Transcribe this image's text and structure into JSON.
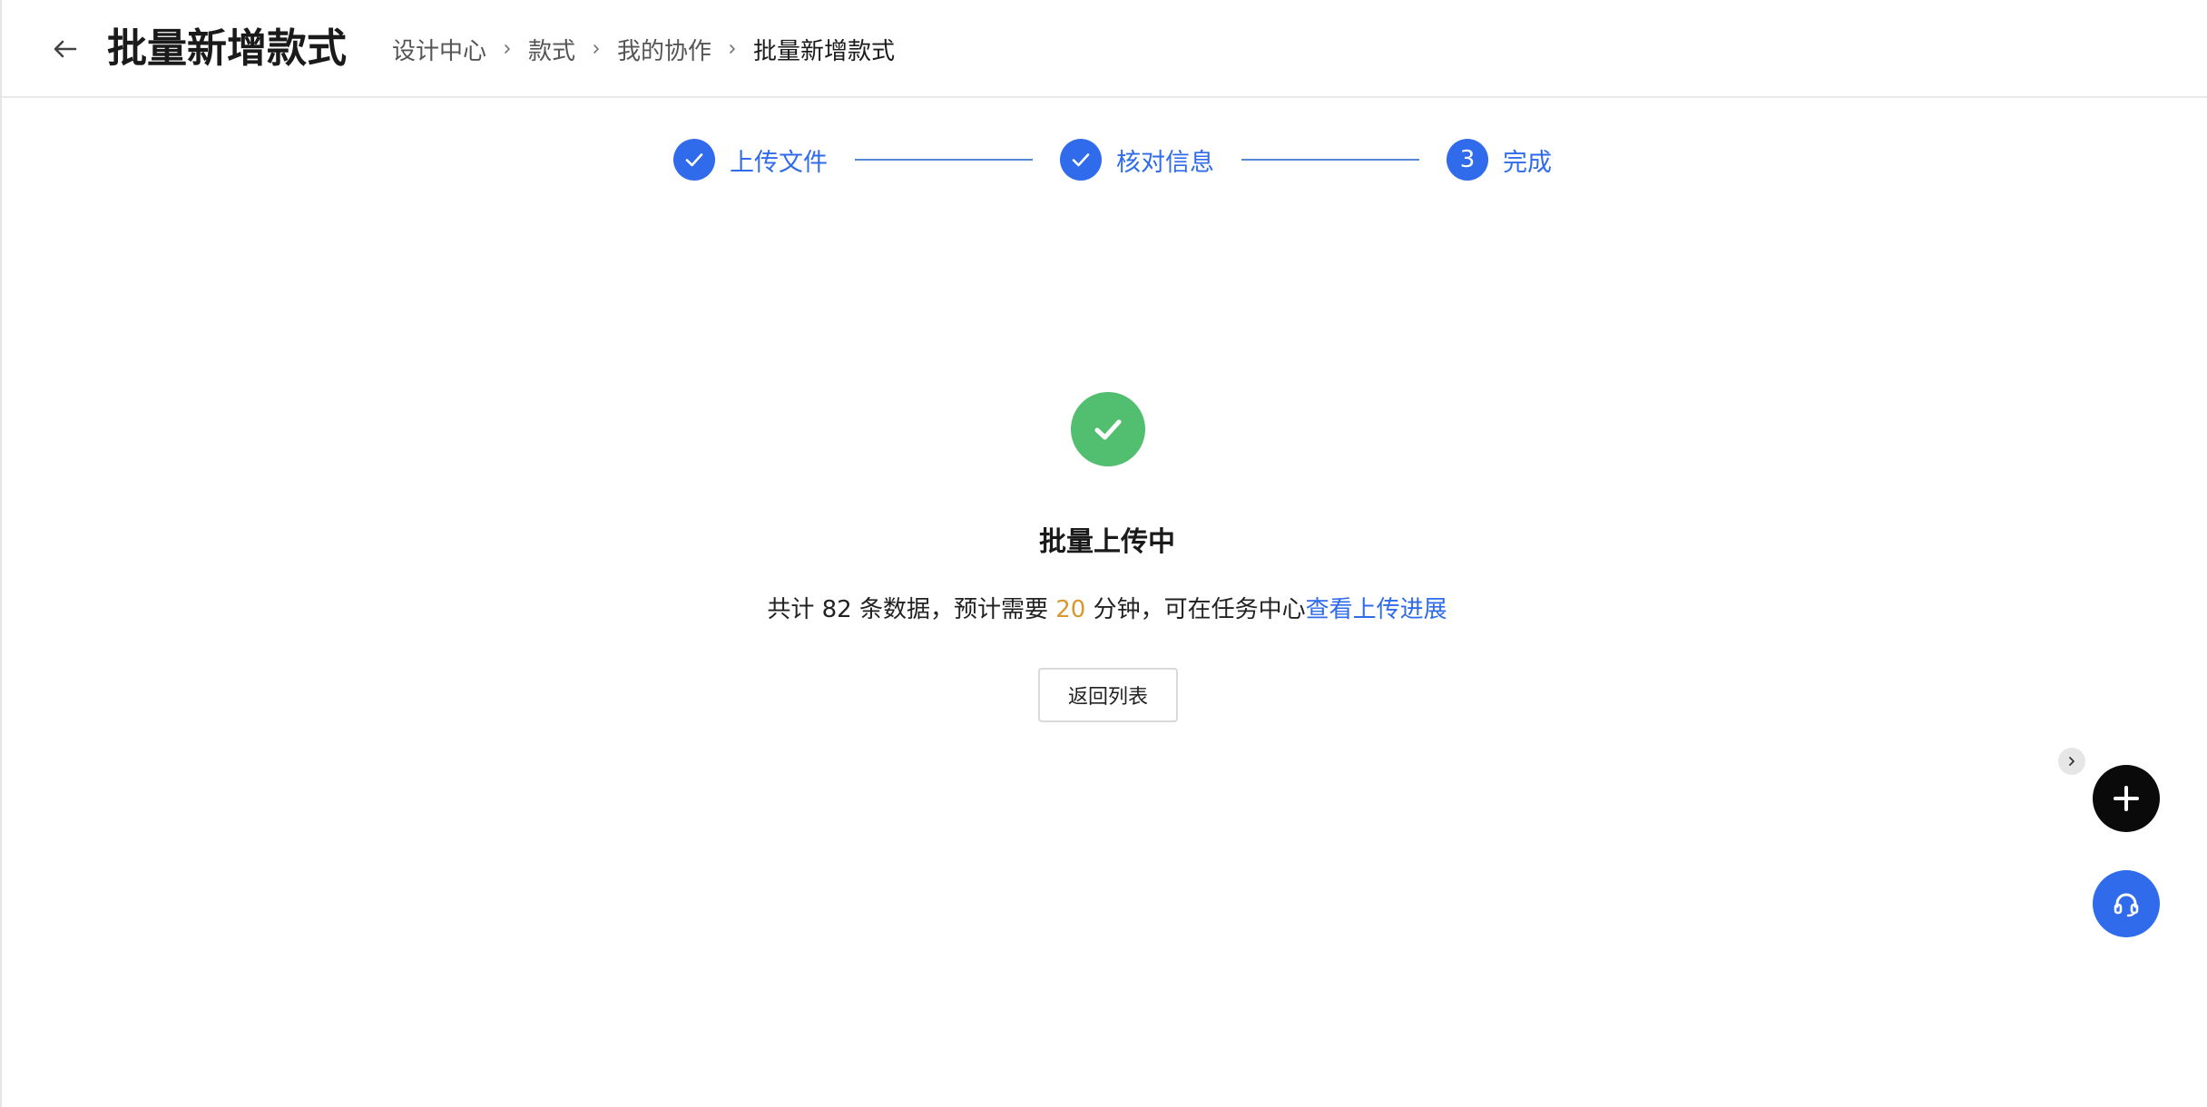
{
  "header": {
    "title": "批量新增款式",
    "back_icon": "arrow-left-icon"
  },
  "breadcrumb": {
    "items": [
      "设计中心",
      "款式",
      "我的协作",
      "批量新增款式"
    ],
    "separator_icon": "chevron-right-icon"
  },
  "steps": {
    "items": [
      {
        "label": "上传文件",
        "status": "finished",
        "icon": "check-icon"
      },
      {
        "label": "核对信息",
        "status": "finished",
        "icon": "check-icon"
      },
      {
        "label": "完成",
        "status": "current",
        "number": "3"
      }
    ]
  },
  "result": {
    "icon": "success-check-icon",
    "title": "批量上传中",
    "desc_prefix": "共计 82 条数据，预计需要 ",
    "desc_minutes": "20",
    "desc_middle": " 分钟，可在任务中心",
    "desc_link": "查看上传进展",
    "back_button": "返回列表"
  },
  "floating": {
    "toggle_icon": "chevron-right-icon",
    "add_icon": "plus-icon",
    "support_icon": "headset-icon"
  },
  "colors": {
    "primary": "#2f6bea",
    "success": "#52be6f",
    "highlight": "#d9982f",
    "fab_dark": "#0a0a0a"
  }
}
